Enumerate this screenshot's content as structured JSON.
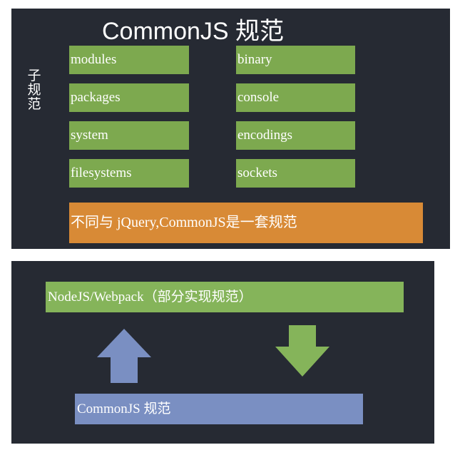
{
  "top_panel": {
    "title": "CommonJS 规范",
    "side_label": "子规范",
    "left_modules": [
      "modules",
      "packages",
      "system",
      "filesystems"
    ],
    "right_modules": [
      "binary",
      "console",
      "encodings",
      "sockets"
    ],
    "note": "不同与 jQuery,CommonJS是一套规范"
  },
  "bottom_panel": {
    "implementation_label": "NodeJS/Webpack（部分实现规范）",
    "spec_label": "CommonJS 规范",
    "arrows": [
      {
        "direction": "up",
        "color": "#7a8fc2",
        "icon": "arrow-up-icon"
      },
      {
        "direction": "down",
        "color": "#85b45a",
        "icon": "arrow-down-icon"
      }
    ]
  },
  "colors": {
    "background": "#262a33",
    "module_green": "#7da94f",
    "note_orange": "#d88a36",
    "spec_blue": "#7a8fc2"
  }
}
